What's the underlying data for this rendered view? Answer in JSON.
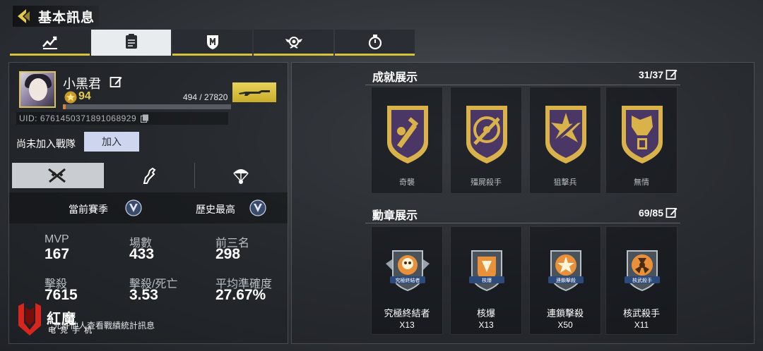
{
  "header": {
    "title": "基本訊息"
  },
  "tabs": [
    {
      "icon": "stats-chart-icon",
      "active": false
    },
    {
      "icon": "clipboard-icon",
      "active": true
    },
    {
      "icon": "shield-badge-icon",
      "active": false
    },
    {
      "icon": "winged-badge-icon",
      "active": false
    },
    {
      "icon": "stopwatch-icon",
      "active": false
    }
  ],
  "profile": {
    "name": "小黑君",
    "level": "94",
    "xp": "494 / 27820",
    "xp_progress": 0.018,
    "uid": "UID: 6761450371891068929",
    "clan_status": "尚未加入戰隊",
    "join_label": "加入",
    "weapon_icon": "rifle-icon"
  },
  "sub_tabs": [
    {
      "icon": "crossed-guns-icon",
      "active": true
    },
    {
      "icon": "arm-icon",
      "active": false
    },
    {
      "icon": "parachute-icon",
      "active": false
    }
  ],
  "season": {
    "current_label": "當前賽季",
    "best_label": "歷史最高"
  },
  "stats": [
    {
      "label": "MVP",
      "value": "167"
    },
    {
      "label": "場數",
      "value": "433"
    },
    {
      "label": "前三名",
      "value": "298"
    },
    {
      "label": "擊殺",
      "value": "7615"
    },
    {
      "label": "擊殺/死亡",
      "value": "3.53"
    },
    {
      "label": "平均準確度",
      "value": "27.67%"
    }
  ],
  "footer_note": "允許他人查看戰績統計訊息",
  "watermark": {
    "brand": "紅魔",
    "sub": "电竞手机"
  },
  "achievements": {
    "title": "成就展示",
    "count": "31/37",
    "items": [
      {
        "name": "奇襲"
      },
      {
        "name": "殭屍殺手"
      },
      {
        "name": "狙擊兵"
      },
      {
        "name": "無情"
      }
    ]
  },
  "medals": {
    "title": "勳章展示",
    "count": "69/85",
    "items": [
      {
        "name": "究極終結者",
        "badge": "究極終結者",
        "count": "X13"
      },
      {
        "name": "核爆",
        "badge": "核爆",
        "count": "X13"
      },
      {
        "name": "連鎖擊殺",
        "badge": "連鎖擊殺",
        "count": "X50"
      },
      {
        "name": "核武殺手",
        "badge": "核武殺手",
        "count": "X11"
      }
    ]
  },
  "colors": {
    "accent": "#d8c23a",
    "level": "#e6c84a",
    "xp_fill": "#d6803a",
    "achievement_gold": "#d9b24a",
    "achievement_purple": "#4a3766",
    "medal_orange": "#e8913a"
  }
}
